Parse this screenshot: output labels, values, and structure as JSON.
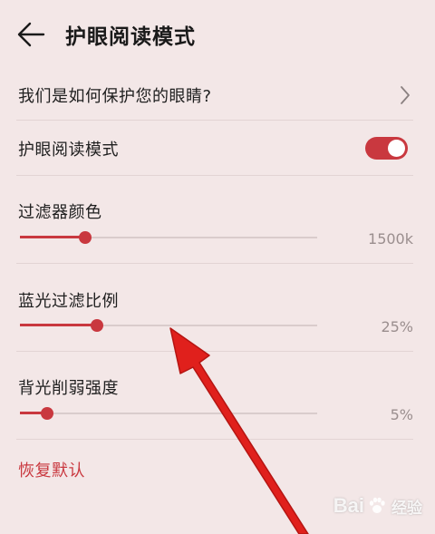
{
  "header": {
    "title": "护眼阅读模式"
  },
  "items": {
    "protect_link": "我们是如何保护您的眼睛?",
    "toggle_label": "护眼阅读模式",
    "toggle_on": true
  },
  "sliders": [
    {
      "label": "过滤器颜色",
      "value_text": "1500k",
      "level": 0.22
    },
    {
      "label": "蓝光过滤比例",
      "value_text": "25%",
      "level": 0.26
    },
    {
      "label": "背光削弱强度",
      "value_text": "5%",
      "level": 0.09
    }
  ],
  "reset_label": "恢复默认",
  "colors": {
    "background": "#f3e7e7",
    "accent": "#c9383f",
    "annotation_arrow": "#e0201c"
  },
  "watermark": {
    "logo_text": "Bai",
    "suffix": "经验"
  }
}
